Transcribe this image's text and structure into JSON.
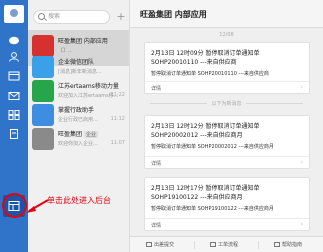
{
  "search": {
    "placeholder": "搜索"
  },
  "conversations": [
    {
      "name": "旺盈集团 内部应用",
      "preview": "【】...",
      "time": "",
      "avatar_color": "#d7312f",
      "active": true
    },
    {
      "name": "企业微信团队",
      "preview": "[消息]新年新消息...",
      "time": "",
      "avatar_color": "#3aa0e8",
      "active": false
    },
    {
      "name": "江苏ertaams移动力量",
      "preview": "欢迎加入江苏ertaams移...",
      "time": "11:22",
      "avatar_color": "#27a54a",
      "active": false
    },
    {
      "name": "掌握行政助手",
      "preview": "企业行政已启用...",
      "time": "11:12",
      "avatar_color": "#3d8de0",
      "active": false
    },
    {
      "name": "旺盈集团",
      "badge": "企业",
      "preview": "欢迎你加入企业...",
      "time": "11:07",
      "avatar_color": "#8a8a8a",
      "active": false
    }
  ],
  "main": {
    "title": "旺盈集团 内部应用",
    "top_time": "12/08",
    "divider_text": "以下为新消息",
    "cards": [
      {
        "head": "2月13日 12时09分 暂停取消订单通知单 SOHP20010110 ---来自供应商",
        "sub": "暂停取消订单通知单 SOHP20010110 ---来自供应商",
        "foot": "详情"
      },
      {
        "head": "2月13日 12时12分 暂停取消订单通知单 SOHP20002012 ---来自供应商月",
        "sub": "暂停取消订单通知单 SOHP20002012 ---来自供应商月",
        "foot": "详情"
      },
      {
        "head": "2月13日 12时17分 暂停取消订单通知单 SOHP19100122 ---来自供应商月",
        "sub": "暂停取消订单通知单 SOHP19100122 ---来自供应商月",
        "foot": "详情"
      }
    ],
    "toolbar": [
      "出差提交",
      "工单流程",
      "帮助指南"
    ]
  },
  "annotation": {
    "text": "单击此处进入后台",
    "color": "#e60012"
  }
}
